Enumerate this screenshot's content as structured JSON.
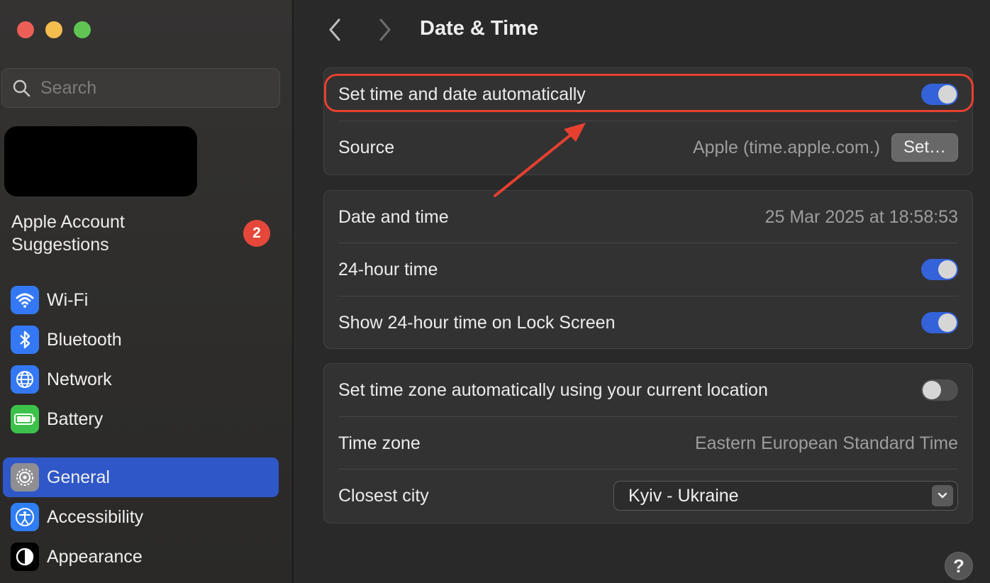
{
  "window": {
    "title": "Date & Time"
  },
  "sidebar": {
    "search_placeholder": "Search",
    "suggestions_line1": "Apple Account",
    "suggestions_line2": "Suggestions",
    "suggestions_badge": "2",
    "items": [
      {
        "label": "Wi-Fi",
        "icon": "wifi-icon",
        "color": "#3478f6"
      },
      {
        "label": "Bluetooth",
        "icon": "bluetooth-icon",
        "color": "#3478f6"
      },
      {
        "label": "Network",
        "icon": "globe-icon",
        "color": "#3478f6"
      },
      {
        "label": "Battery",
        "icon": "battery-icon",
        "color": "#3cc24a"
      },
      {
        "label": "General",
        "icon": "gear-icon",
        "color": "#8e8e93",
        "active": true
      },
      {
        "label": "Accessibility",
        "icon": "accessibility-icon",
        "color": "#2f7ef5"
      },
      {
        "label": "Appearance",
        "icon": "appearance-icon",
        "color": "#000000"
      }
    ]
  },
  "main": {
    "title": "Date & Time",
    "auto_group": {
      "auto_label": "Set time and date automatically",
      "auto_on": true,
      "source_label": "Source",
      "source_value": "Apple (time.apple.com.)",
      "set_button": "Set…"
    },
    "time_group": {
      "datetime_label": "Date and time",
      "datetime_value": "25 Mar 2025 at 18:58:53",
      "h24_label": "24-hour time",
      "h24_on": true,
      "lock_label": "Show 24-hour time on Lock Screen",
      "lock_on": true
    },
    "zone_group": {
      "auto_zone_label": "Set time zone automatically using your current location",
      "auto_zone_on": false,
      "zone_label": "Time zone",
      "zone_value": "Eastern European Standard Time",
      "city_label": "Closest city",
      "city_value": "Kyiv - Ukraine"
    },
    "help_label": "?"
  },
  "colors": {
    "accent": "#3462d8",
    "highlight": "#e8402f",
    "active_sidebar": "#2f57c8"
  }
}
